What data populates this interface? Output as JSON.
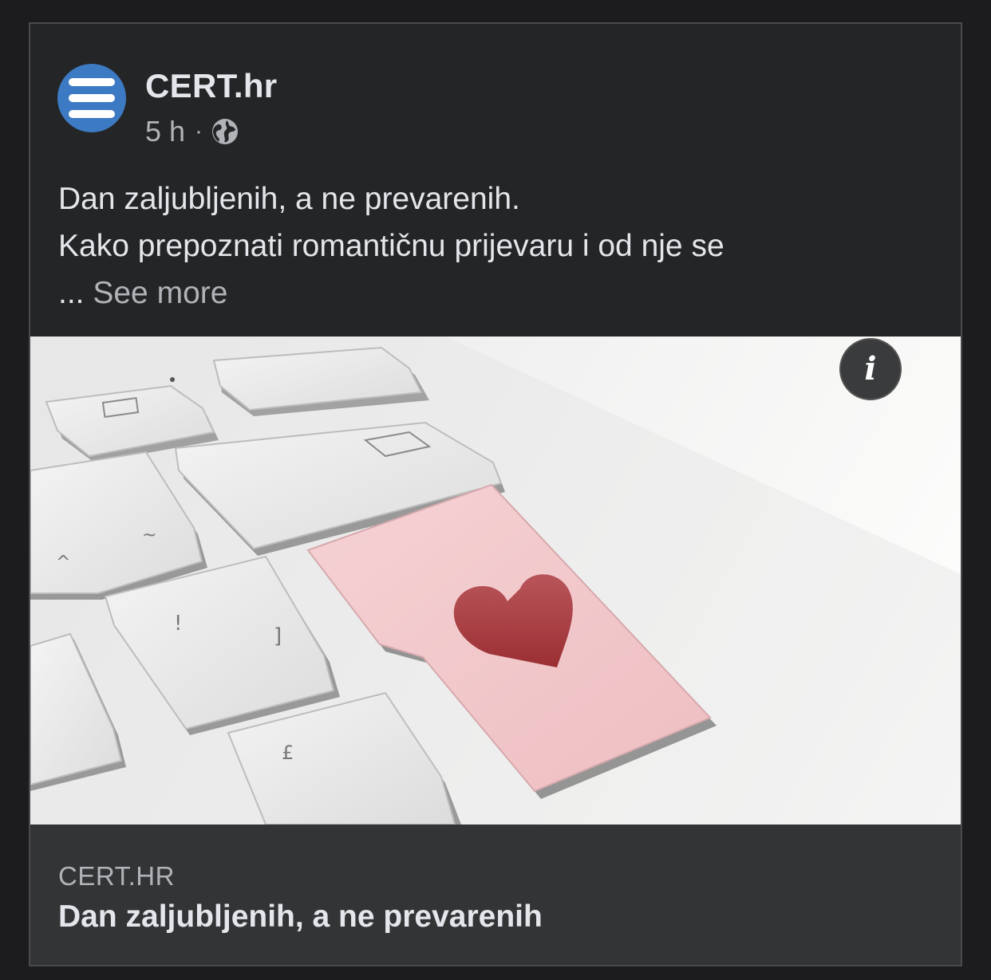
{
  "post": {
    "page_name": "CERT.hr",
    "time": "5 h",
    "separator": "·",
    "privacy_icon": "globe-icon",
    "text_line1": "Dan zaljubljenih, a ne prevarenih.",
    "text_line2": "Kako prepoznati romantičnu prijevaru i od nje se",
    "ellipsis": "...",
    "see_more": "See more"
  },
  "media": {
    "info_label": "i",
    "info_icon": "info-icon"
  },
  "link_preview": {
    "domain": "CERT.HR",
    "title": "Dan zaljubljenih, a ne prevarenih"
  },
  "colors": {
    "background": "#1c1c1e",
    "card": "#242526",
    "footer": "#323436",
    "avatar_blue": "#3d7ac4",
    "primary_text": "#e4e6eb",
    "secondary_text": "#b0b3b8",
    "heart": "#a83a3a",
    "pink_key": "#f2c9cc"
  }
}
